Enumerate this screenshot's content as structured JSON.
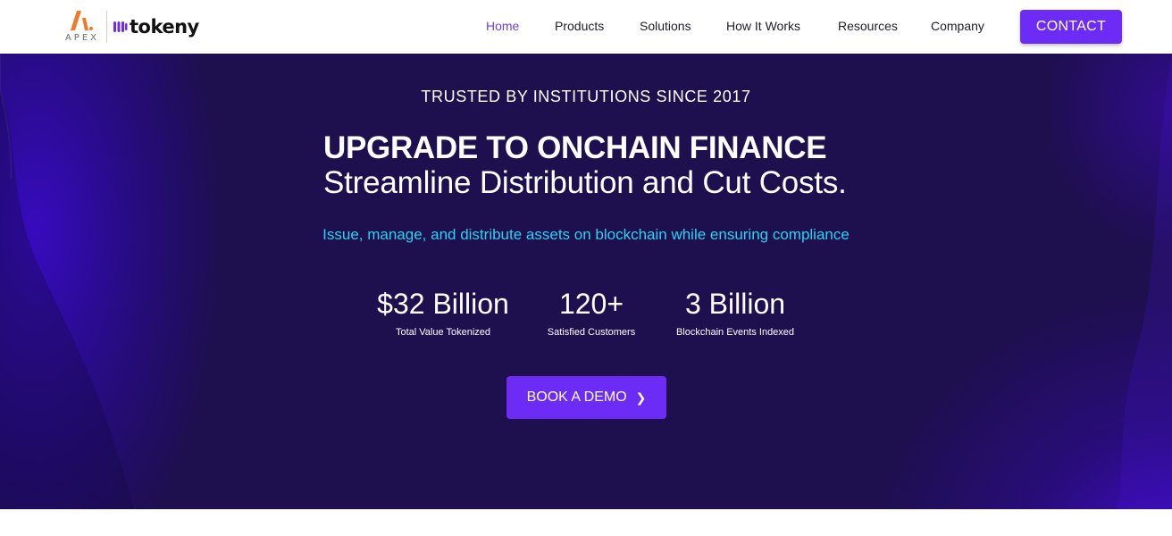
{
  "header": {
    "brand": {
      "apex_text": "APEX",
      "tokeny_text": "tokeny",
      "apex_color": "#f07a2a",
      "tokeny_mark_color": "#6d2cf5"
    },
    "nav": [
      {
        "label": "Home",
        "active": true
      },
      {
        "label": "Products",
        "active": false
      },
      {
        "label": "Solutions",
        "active": false
      },
      {
        "label": "How It Works",
        "active": false
      },
      {
        "label": "Resources",
        "active": false
      },
      {
        "label": "Company",
        "active": false
      }
    ],
    "contact_label": "CONTACT"
  },
  "hero": {
    "eyebrow": "TRUSTED BY INSTITUTIONS SINCE 2017",
    "headline": "UPGRADE TO ONCHAIN FINANCE",
    "subheadline": "Streamline Distribution and Cut Costs.",
    "tagline": "Issue, manage, and distribute assets on blockchain while ensuring compliance",
    "stats": [
      {
        "value": "$32 Billion",
        "label": "Total Value Tokenized"
      },
      {
        "value": "120+",
        "label": "Satisfied Customers"
      },
      {
        "value": "3 Billion",
        "label": "Blockchain Events Indexed"
      }
    ],
    "cta_label": "BOOK A DEMO",
    "cta_icon": "chevron-right-icon"
  },
  "colors": {
    "accent": "#6d2cf5",
    "nav_active": "#6b3ff5",
    "hero_bg": "#1e0f4f",
    "tagline": "#27d4f2"
  }
}
